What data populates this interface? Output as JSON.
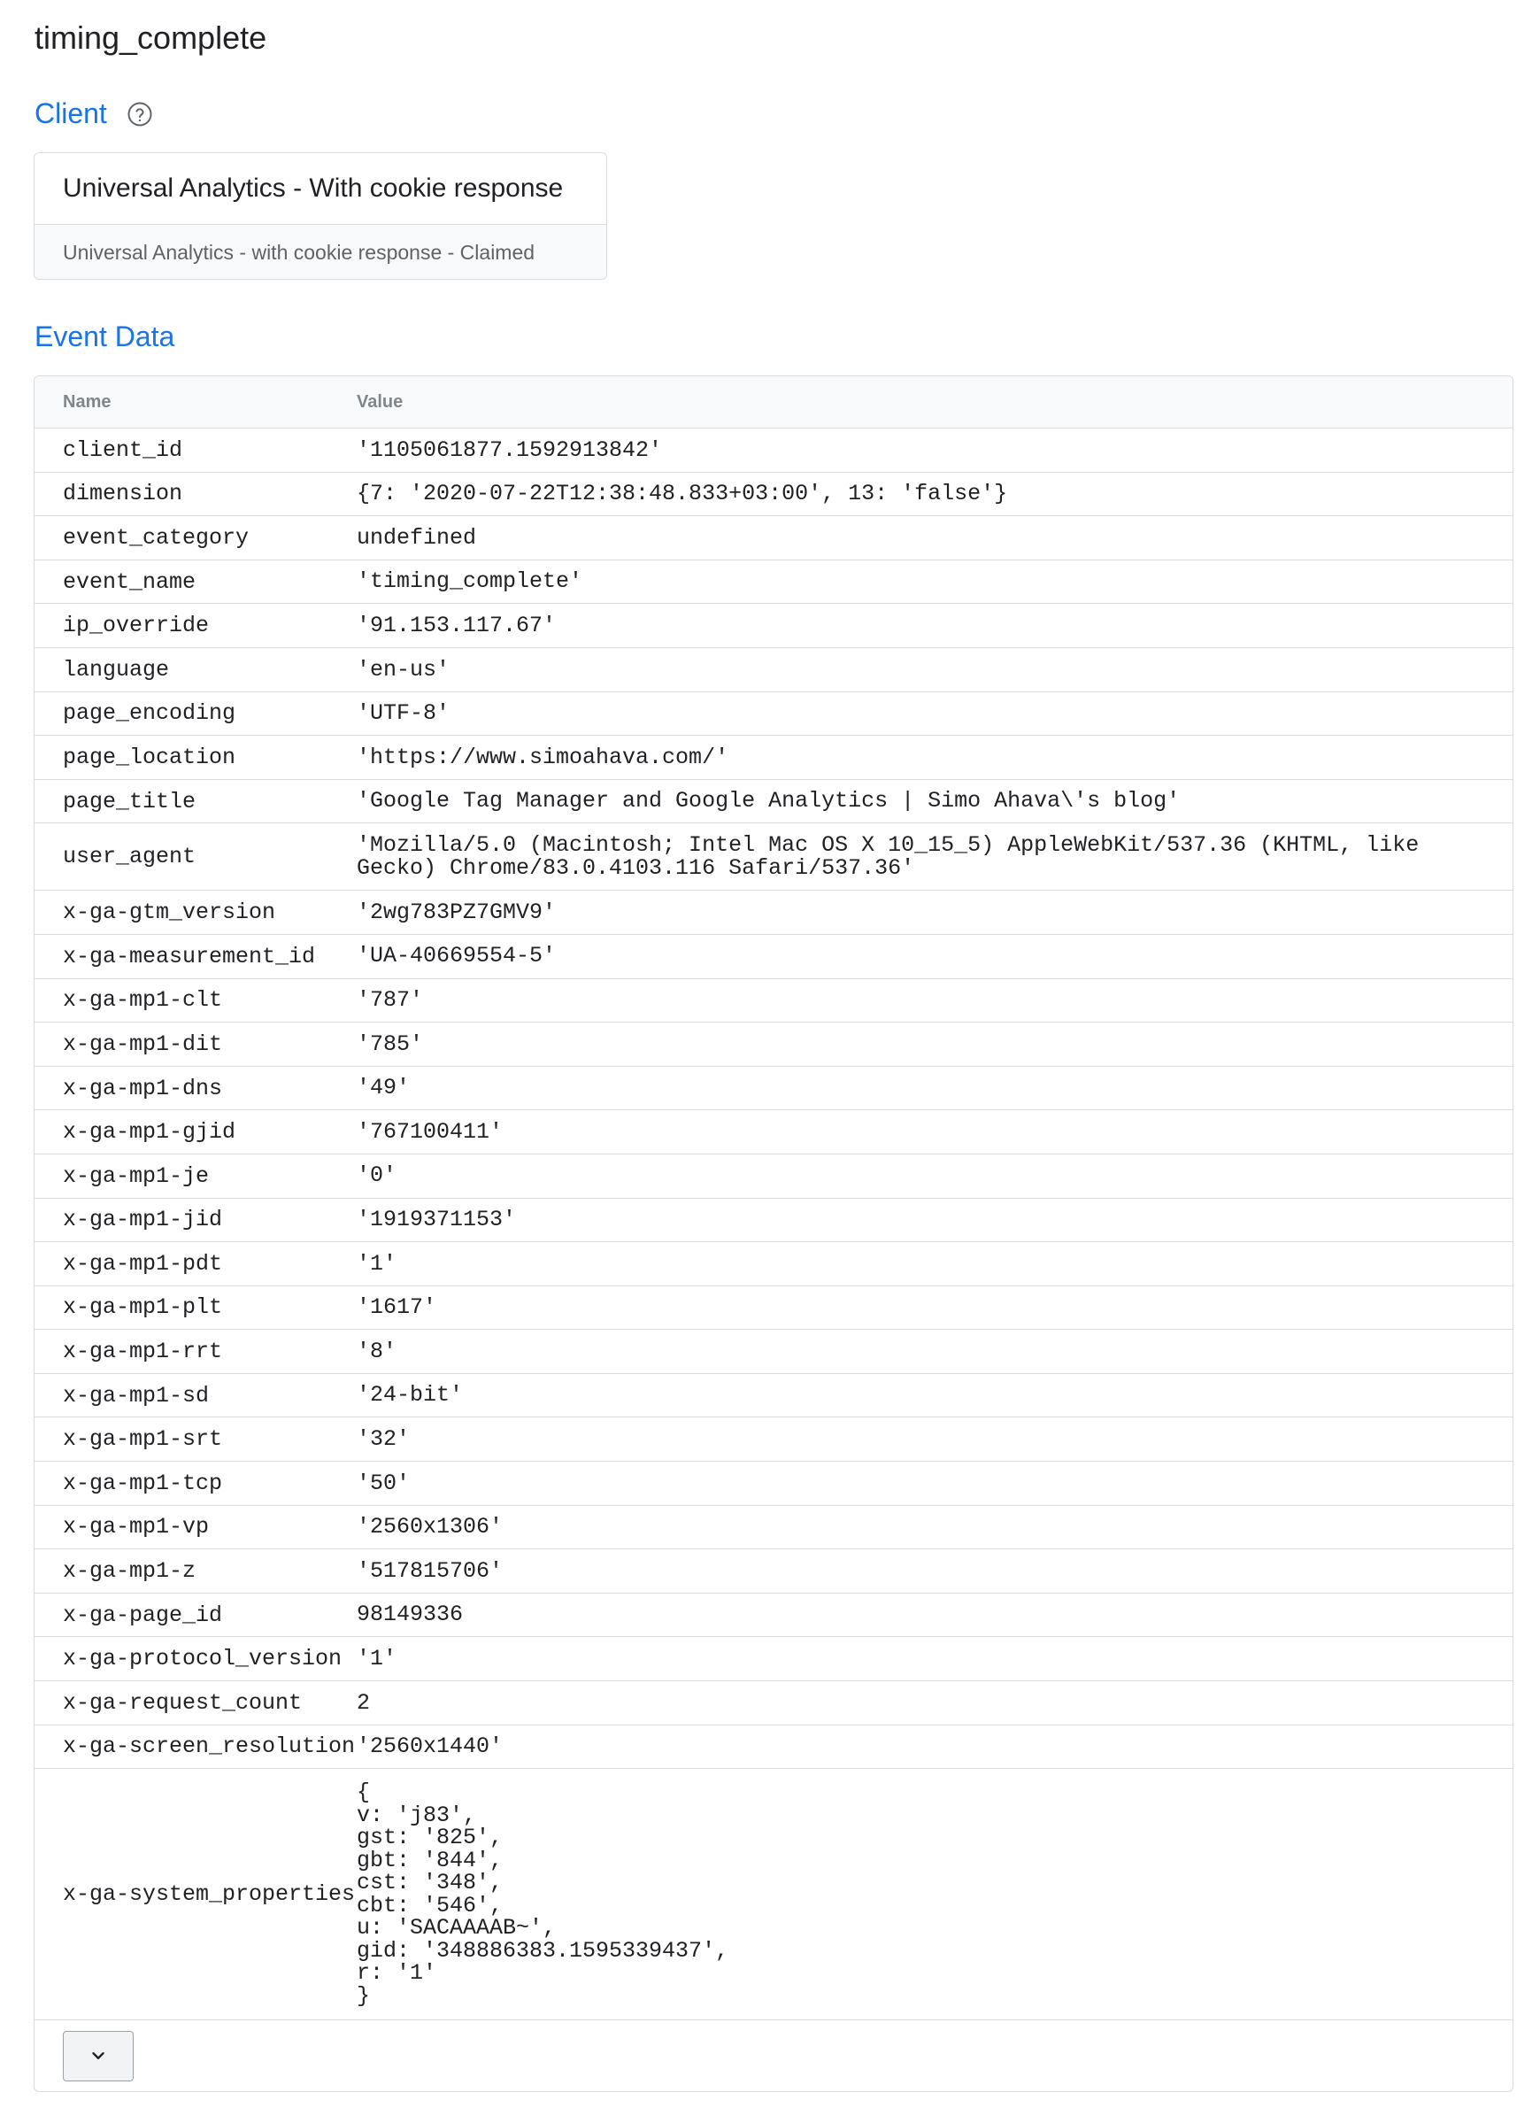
{
  "page": {
    "title": "timing_complete"
  },
  "client": {
    "heading": "Client",
    "help_icon": "help-circle-icon",
    "card_title": "Universal Analytics - With cookie response",
    "card_subtitle": "Universal Analytics - with cookie response - Claimed"
  },
  "event_data": {
    "heading": "Event Data",
    "columns": {
      "name": "Name",
      "value": "Value"
    },
    "rows": [
      {
        "name": "client_id",
        "value": "'1105061877.1592913842'"
      },
      {
        "name": "dimension",
        "value": "{7: '2020-07-22T12:38:48.833+03:00', 13: 'false'}"
      },
      {
        "name": "event_category",
        "value": "undefined"
      },
      {
        "name": "event_name",
        "value": "'timing_complete'"
      },
      {
        "name": "ip_override",
        "value": "'91.153.117.67'"
      },
      {
        "name": "language",
        "value": "'en-us'"
      },
      {
        "name": "page_encoding",
        "value": "'UTF-8'"
      },
      {
        "name": "page_location",
        "value": "'https://www.simoahava.com/'"
      },
      {
        "name": "page_title",
        "value": "'Google Tag Manager and Google Analytics | Simo Ahava\\'s blog'"
      },
      {
        "name": "user_agent",
        "value": "'Mozilla/5.0 (Macintosh; Intel Mac OS X 10_15_5) AppleWebKit/537.36 (KHTML, like\nGecko) Chrome/83.0.4103.116 Safari/537.36'"
      },
      {
        "name": "x-ga-gtm_version",
        "value": "'2wg783PZ7GMV9'"
      },
      {
        "name": "x-ga-measurement_id",
        "value": "'UA-40669554-5'"
      },
      {
        "name": "x-ga-mp1-clt",
        "value": "'787'"
      },
      {
        "name": "x-ga-mp1-dit",
        "value": "'785'"
      },
      {
        "name": "x-ga-mp1-dns",
        "value": "'49'"
      },
      {
        "name": "x-ga-mp1-gjid",
        "value": "'767100411'"
      },
      {
        "name": "x-ga-mp1-je",
        "value": "'0'"
      },
      {
        "name": "x-ga-mp1-jid",
        "value": "'1919371153'"
      },
      {
        "name": "x-ga-mp1-pdt",
        "value": "'1'"
      },
      {
        "name": "x-ga-mp1-plt",
        "value": "'1617'"
      },
      {
        "name": "x-ga-mp1-rrt",
        "value": "'8'"
      },
      {
        "name": "x-ga-mp1-sd",
        "value": "'24-bit'"
      },
      {
        "name": "x-ga-mp1-srt",
        "value": "'32'"
      },
      {
        "name": "x-ga-mp1-tcp",
        "value": "'50'"
      },
      {
        "name": "x-ga-mp1-vp",
        "value": "'2560x1306'"
      },
      {
        "name": "x-ga-mp1-z",
        "value": "'517815706'"
      },
      {
        "name": "x-ga-page_id",
        "value": "98149336"
      },
      {
        "name": "x-ga-protocol_version",
        "value": "'1'"
      },
      {
        "name": "x-ga-request_count",
        "value": "2"
      },
      {
        "name": "x-ga-screen_resolution",
        "value": "'2560x1440'"
      },
      {
        "name": "x-ga-system_properties",
        "value": "{\nv: 'j83',\ngst: '825',\ngbt: '844',\ncst: '348',\ncbt: '546',\nu: 'SACAAAAB~',\ngid: '348886383.1595339437',\nr: '1'\n}"
      }
    ],
    "expand_icon": "chevron-down-icon"
  }
}
